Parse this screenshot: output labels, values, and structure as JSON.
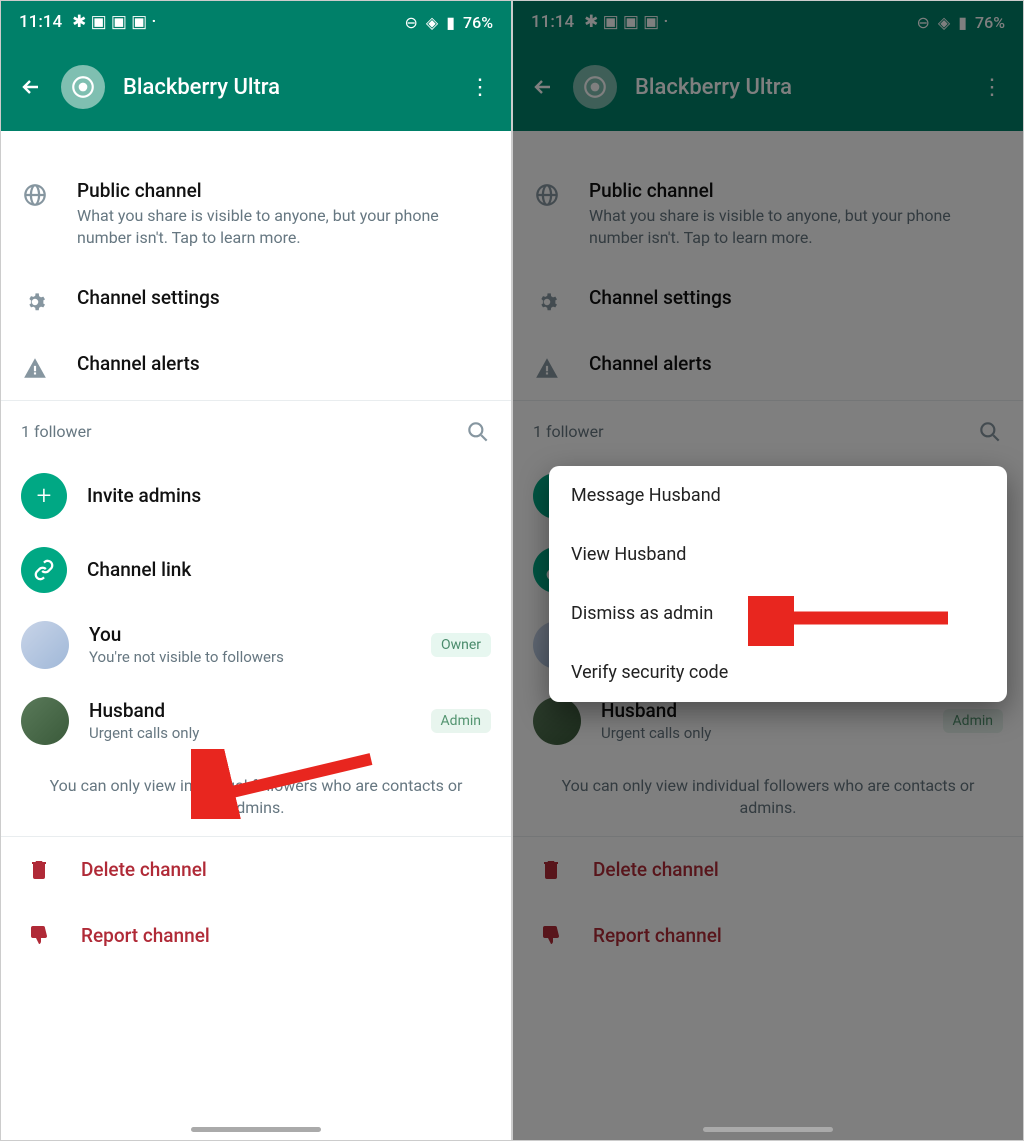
{
  "status": {
    "time": "11:14",
    "battery": "76%"
  },
  "header": {
    "title": "Blackberry Ultra"
  },
  "info": {
    "public_title": "Public channel",
    "public_sub": "What you share is visible to anyone, but your phone number isn't. Tap to learn more.",
    "settings": "Channel settings",
    "alerts": "Channel alerts"
  },
  "followers": {
    "count_label": "1 follower",
    "invite_admins": "Invite admins",
    "channel_link": "Channel link",
    "you_name": "You",
    "you_sub": "You're not visible to followers",
    "owner_badge": "Owner",
    "husband_name": "Husband",
    "husband_sub": "Urgent calls only",
    "admin_badge": "Admin",
    "note": "You can only view individual followers who are contacts or admins."
  },
  "danger": {
    "delete": "Delete channel",
    "report": "Report channel"
  },
  "popup": {
    "message": "Message Husband",
    "view": "View Husband",
    "dismiss": "Dismiss as admin",
    "verify": "Verify security code"
  }
}
